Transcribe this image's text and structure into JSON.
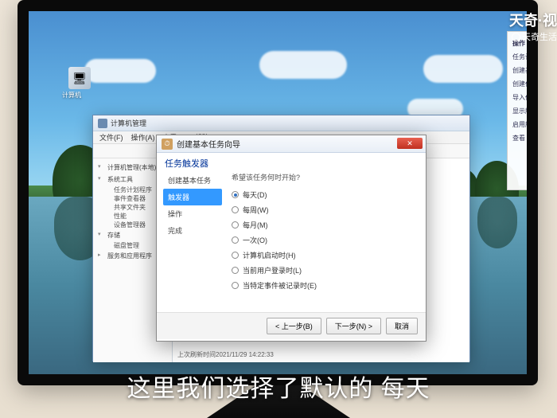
{
  "watermark_top": "天奇·视",
  "watermark_sub": "天奇生活",
  "desktop_icon_label": "计算机",
  "main_window": {
    "title": "计算机管理",
    "menu": [
      "文件(F)",
      "操作(A)",
      "查看(V)",
      "帮助(H)"
    ],
    "tree": {
      "root": "计算机管理(本地)",
      "sys": "系统工具",
      "items": [
        "任务计划程序",
        "事件查看器",
        "共享文件夹",
        "性能",
        "设备管理器"
      ],
      "storage": "存储",
      "disk": "磁盘管理",
      "services": "服务和应用程序"
    },
    "status": "上次刷新时间2021/11/29 14:22:33"
  },
  "right_panel": {
    "title": "操作",
    "items": [
      "任务计划程序",
      "创建基本任务...",
      "创建任务...",
      "导入任务...",
      "显示所有正在运行...",
      "启用所有任务历史",
      "查看"
    ]
  },
  "dialog": {
    "title": "创建基本任务向导",
    "heading": "任务触发器",
    "left": [
      "创建基本任务",
      "触发器",
      "操作",
      "完成"
    ],
    "right_label": "希望该任务何时开始?",
    "options": [
      "每天(D)",
      "每周(W)",
      "每月(M)",
      "一次(O)",
      "计算机启动时(H)",
      "当前用户登录时(L)",
      "当特定事件被记录时(E)"
    ],
    "selected": 0,
    "buttons": {
      "back": "< 上一步(B)",
      "next": "下一步(N) >",
      "cancel": "取消"
    }
  },
  "subtitle": "这里我们选择了默认的 每天"
}
